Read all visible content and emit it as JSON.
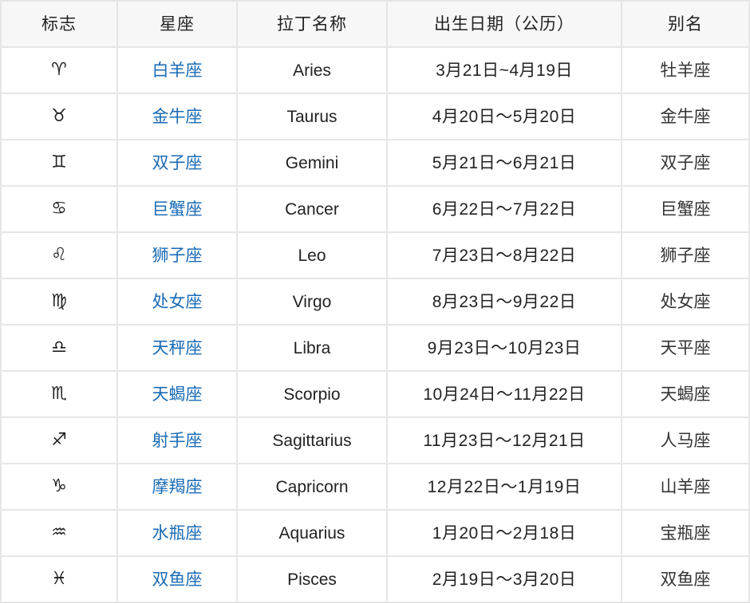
{
  "table": {
    "headers": {
      "symbol": "标志",
      "name": "星座",
      "latin": "拉丁名称",
      "date": "出生日期（公历）",
      "alias": "别名"
    },
    "link_color": "#1a6bb5",
    "rows": [
      {
        "symbol": "♈",
        "symbol_icon": "aries-icon",
        "name": "白羊座",
        "latin": "Aries",
        "date": "3月21日~4月19日",
        "alias": "牡羊座"
      },
      {
        "symbol": "♉",
        "symbol_icon": "taurus-icon",
        "name": "金牛座",
        "latin": "Taurus",
        "date": "4月20日～5月20日",
        "alias": "金牛座"
      },
      {
        "symbol": "♊",
        "symbol_icon": "gemini-icon",
        "name": "双子座",
        "latin": "Gemini",
        "date": "5月21日～6月21日",
        "alias": "双子座"
      },
      {
        "symbol": "♋",
        "symbol_icon": "cancer-icon",
        "name": "巨蟹座",
        "latin": "Cancer",
        "date": "6月22日～7月22日",
        "alias": "巨蟹座"
      },
      {
        "symbol": "♌",
        "symbol_icon": "leo-icon",
        "name": "狮子座",
        "latin": "Leo",
        "date": "7月23日～8月22日",
        "alias": "狮子座"
      },
      {
        "symbol": "♍",
        "symbol_icon": "virgo-icon",
        "name": "处女座",
        "latin": "Virgo",
        "date": "8月23日～9月22日",
        "alias": "处女座"
      },
      {
        "symbol": "♎",
        "symbol_icon": "libra-icon",
        "name": "天秤座",
        "latin": "Libra",
        "date": "9月23日～10月23日",
        "alias": "天平座"
      },
      {
        "symbol": "♏",
        "symbol_icon": "scorpio-icon",
        "name": "天蝎座",
        "latin": "Scorpio",
        "date": "10月24日～11月22日",
        "alias": "天蝎座"
      },
      {
        "symbol": "♐",
        "symbol_icon": "sagittarius-icon",
        "name": "射手座",
        "latin": "Sagittarius",
        "date": "11月23日～12月21日",
        "alias": "人马座"
      },
      {
        "symbol": "♑",
        "symbol_icon": "capricorn-icon",
        "name": "摩羯座",
        "latin": "Capricorn",
        "date": "12月22日～1月19日",
        "alias": "山羊座"
      },
      {
        "symbol": "♒",
        "symbol_icon": "aquarius-icon",
        "name": "水瓶座",
        "latin": "Aquarius",
        "date": "1月20日～2月18日",
        "alias": "宝瓶座"
      },
      {
        "symbol": "♓",
        "symbol_icon": "pisces-icon",
        "name": "双鱼座",
        "latin": "Pisces",
        "date": "2月19日～3月20日",
        "alias": "双鱼座"
      }
    ]
  }
}
